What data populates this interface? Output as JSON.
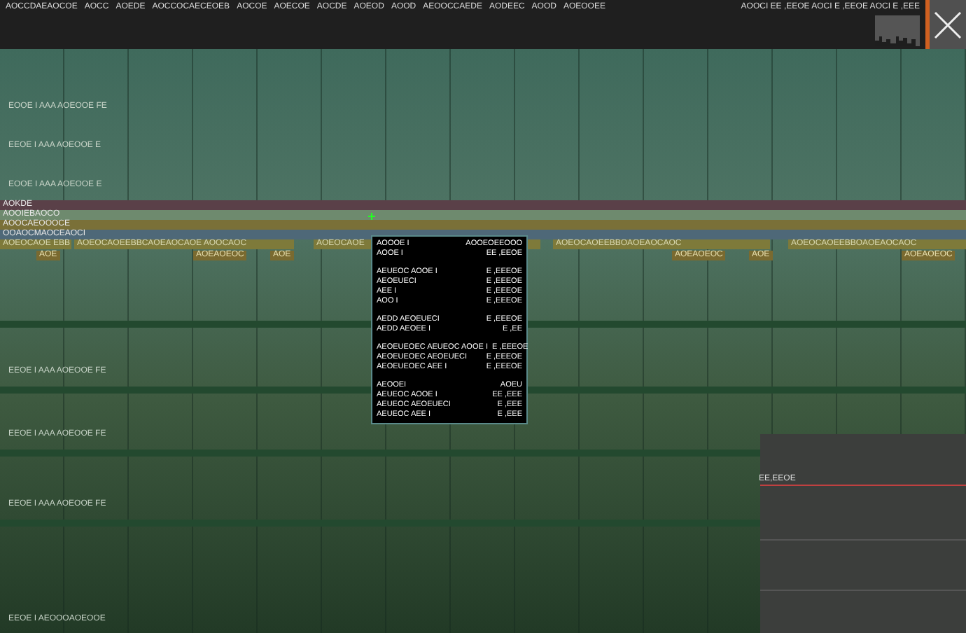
{
  "menu": [
    "AOCCDAEAOCOE",
    "AOCC",
    "AOEDE",
    "AOCCOCAECEOEB",
    "AOCOE",
    "AOECOE",
    "AOCDE",
    "AOEOD",
    "AOOD",
    "AEOOCCAEDE",
    "AODEEC",
    "AOOD",
    "AOEOOEE"
  ],
  "status_readout": "AOOCI EE ,EEOE AOCI E ,EEOE AOCI E ,EEE",
  "upper_tracks": [
    "EOOE I AAA AOEOOE FE",
    "EEOE I AAA AOEOOE E",
    "EOOE I AAA AOEOOE E"
  ],
  "bands": [
    {
      "label": "AOKDE",
      "color": "#5a4048"
    },
    {
      "label": "AOOIEBAOCO",
      "color": "#6e8a6e"
    },
    {
      "label": "AOOCAEOOOCE",
      "color": "#7a7038"
    },
    {
      "label": "OOAOCMAOCEAOCI",
      "color": "#4e6878"
    }
  ],
  "clips": [
    "AOEOCAOE EBB",
    "AOEOCAOEEBBCAOEAOCAOE AOOCAOC",
    "AOEOCAOE",
    "AOEOCAOEEBBOAOEAOCAOC",
    "AOEOCAOEEBBOAOEAOCAOC"
  ],
  "markers": [
    "AOE",
    "AOEAOEOC",
    "AOE",
    "AOEAOEOC",
    "AOE",
    "AOEAOEOC"
  ],
  "lower_tracks": [
    "EEOE I AAA AOEOOE FE",
    "EEOE I AAA AOEOOE FE",
    "EEOE I AAA AOEOOE FE",
    "EEOE I AEOOOAOEOOE"
  ],
  "envelope": {
    "reading": "EE,EEOE"
  },
  "tooltip": [
    [
      {
        "label": "AOOOE I",
        "value": "AOOEOEEOOO"
      },
      {
        "label": "AOOE I",
        "value": "EE ,EEOE"
      }
    ],
    [
      {
        "label": "AEUEOC AOOE I",
        "value": "E ,EEEOE"
      },
      {
        "label": "AEOEUECI",
        "value": "E ,EEEOE"
      },
      {
        "label": "AEE I",
        "value": "E ,EEEOE"
      },
      {
        "label": "AOO I",
        "value": "E ,EEEOE"
      }
    ],
    [
      {
        "label": "AEDD AEOEUECI",
        "value": "E ,EEEOE"
      },
      {
        "label": "AEDD AEOEE I",
        "value": "E ,EE"
      }
    ],
    [
      {
        "label": "AEOEUEOEC AEUEOC AOOE I",
        "value": "E ,EEEOE"
      },
      {
        "label": "AEOEUEOEC AEOEUECI",
        "value": "E ,EEEOE"
      },
      {
        "label": "AEOEUEOEC AEE I",
        "value": "E ,EEEOE"
      }
    ],
    [
      {
        "label": "AEOOEI",
        "value": "AOEU"
      },
      {
        "label": "AEUEOC AOOE I",
        "value": "EE ,EEE"
      },
      {
        "label": "AEUEOC AEOEUECI",
        "value": "E ,EEE"
      },
      {
        "label": "AEUEOC AEE I",
        "value": "E ,EEE"
      }
    ]
  ]
}
